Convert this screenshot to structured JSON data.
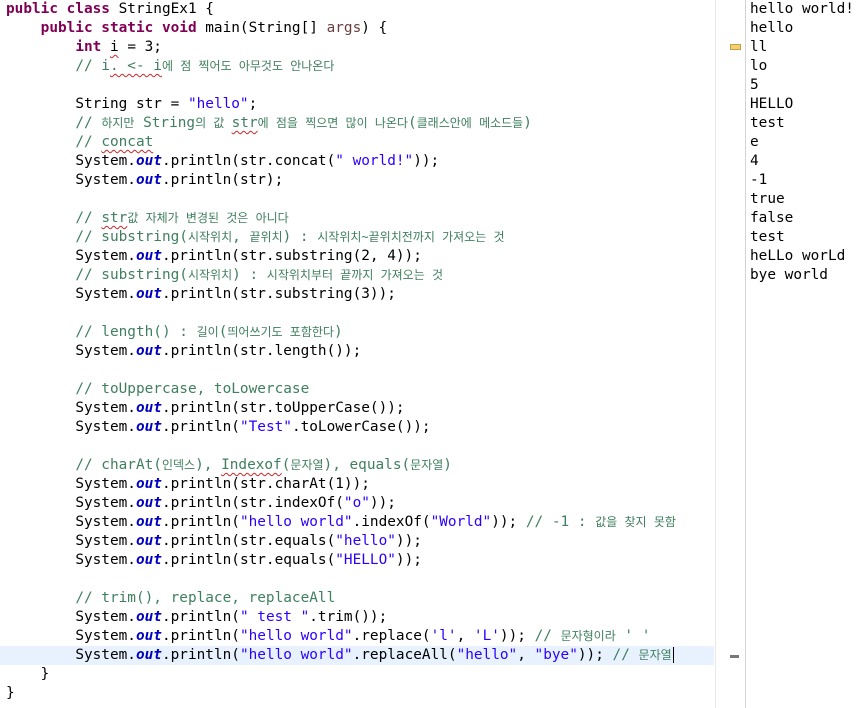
{
  "editor": {
    "lines": {
      "l01_a": "public class",
      "l01_b": " StringEx1 {",
      "l02_a": "public static void",
      "l02_b": " main(String[] ",
      "l02_c": "args",
      "l02_d": ") {",
      "l03_a": "int",
      "l03_b": " ",
      "l03_c": "i",
      "l03_d": " = 3;",
      "l04_a": "// i",
      "l04_b": ". <- i",
      "l04_c": "에 점 찍어도 아무것도 안나온다",
      "l06_a": "String str = ",
      "l06_b": "\"hello\"",
      "l06_c": ";",
      "l07_a": "// ",
      "l07_b": "하지만",
      "l07_c": " String",
      "l07_d": "의 값 ",
      "l07_e": "str",
      "l07_f": "에 점을 찍으면 많이 나온다",
      "l07_g": "(",
      "l07_h": "클래스안에 메소드들",
      "l07_i": ")",
      "l08_a": "// ",
      "l08_b": "concat",
      "l09_a": "System.",
      "l09_out": "out",
      "l09_b": ".println(str.concat(",
      "l09_s": "\" world!\"",
      "l09_c": "));",
      "l10_a": "System.",
      "l10_out": "out",
      "l10_b": ".println(str);",
      "l12_a": "// ",
      "l12_b": "str",
      "l12_c": "값 자체가 변경된 것은 아니다",
      "l13_a": "// substring(",
      "l13_b": "시작위치",
      "l13_c": ", ",
      "l13_d": "끝위치",
      "l13_e": ") : ",
      "l13_f": "시작위치~끝위치전까지 가져오는 것",
      "l14_a": "System.",
      "l14_out": "out",
      "l14_b": ".println(str.substring(2, 4));",
      "l15_a": "// substring(",
      "l15_b": "시작위치",
      "l15_c": ") : ",
      "l15_d": "시작위치부터 끝까지 가져오는 것",
      "l16_a": "System.",
      "l16_out": "out",
      "l16_b": ".println(str.substring(3));",
      "l18_a": "// length() : ",
      "l18_b": "길이",
      "l18_c": "(",
      "l18_d": "띄어쓰기도 포함한다",
      "l18_e": ")",
      "l19_a": "System.",
      "l19_out": "out",
      "l19_b": ".println(str.length());",
      "l21_a": "// toUppercase, toLowercase",
      "l22_a": "System.",
      "l22_out": "out",
      "l22_b": ".println(str.toUpperCase());",
      "l23_a": "System.",
      "l23_out": "out",
      "l23_b": ".println(",
      "l23_s": "\"Test\"",
      "l23_c": ".toLowerCase());",
      "l25_a": "// charAt(",
      "l25_b": "인덱스",
      "l25_c": "), ",
      "l25_d": "Indexof",
      "l25_e": "(",
      "l25_f": "문자열",
      "l25_g": "), equals(",
      "l25_h": "문자열",
      "l25_i": ")",
      "l26_a": "System.",
      "l26_out": "out",
      "l26_b": ".println(str.charAt(1));",
      "l27_a": "System.",
      "l27_out": "out",
      "l27_b": ".println(str.indexOf(",
      "l27_s": "\"o\"",
      "l27_c": "));",
      "l28_a": "System.",
      "l28_out": "out",
      "l28_b": ".println(",
      "l28_s1": "\"hello world\"",
      "l28_c": ".indexOf(",
      "l28_s2": "\"World\"",
      "l28_d": ")); ",
      "l28_cm": "// -1 : ",
      "l28_ck": "값을 찾지 못함",
      "l29_a": "System.",
      "l29_out": "out",
      "l29_b": ".println(str.equals(",
      "l29_s": "\"hello\"",
      "l29_c": "));",
      "l30_a": "System.",
      "l30_out": "out",
      "l30_b": ".println(str.equals(",
      "l30_s": "\"HELLO\"",
      "l30_c": "));",
      "l32_a": "// trim(), replace, replaceAll",
      "l33_a": "System.",
      "l33_out": "out",
      "l33_b": ".println(",
      "l33_s": "\" test \"",
      "l33_c": ".trim());",
      "l34_a": "System.",
      "l34_out": "out",
      "l34_b": ".println(",
      "l34_s1": "\"hello world\"",
      "l34_c": ".replace(",
      "l34_s2": "'l'",
      "l34_d": ", ",
      "l34_s3": "'L'",
      "l34_e": ")); ",
      "l34_cm": "// ",
      "l34_ck": "문자형이라",
      "l34_cm2": " ' '",
      "l35_a": "System.",
      "l35_out": "out",
      "l35_b": ".println(",
      "l35_s1": "\"hello world\"",
      "l35_c": ".replaceAll(",
      "l35_s2": "\"hello\"",
      "l35_d": ", ",
      "l35_s3": "\"bye\"",
      "l35_e": ")); ",
      "l35_cm": "// ",
      "l35_ck": "문자열",
      "l36_a": "}",
      "l37_a": "}"
    }
  },
  "console": {
    "lines": [
      "hello world!",
      "hello",
      "ll",
      "lo",
      "5",
      "HELLO",
      "test",
      "e",
      "4",
      "-1",
      "true",
      "false",
      "test",
      "heLLo worLd",
      "bye world"
    ]
  },
  "colors": {
    "keyword": "#7f0055",
    "string": "#2a00ff",
    "comment": "#3f7f5f",
    "static_field": "#0000c0",
    "current_line": "#e8f2fe"
  }
}
